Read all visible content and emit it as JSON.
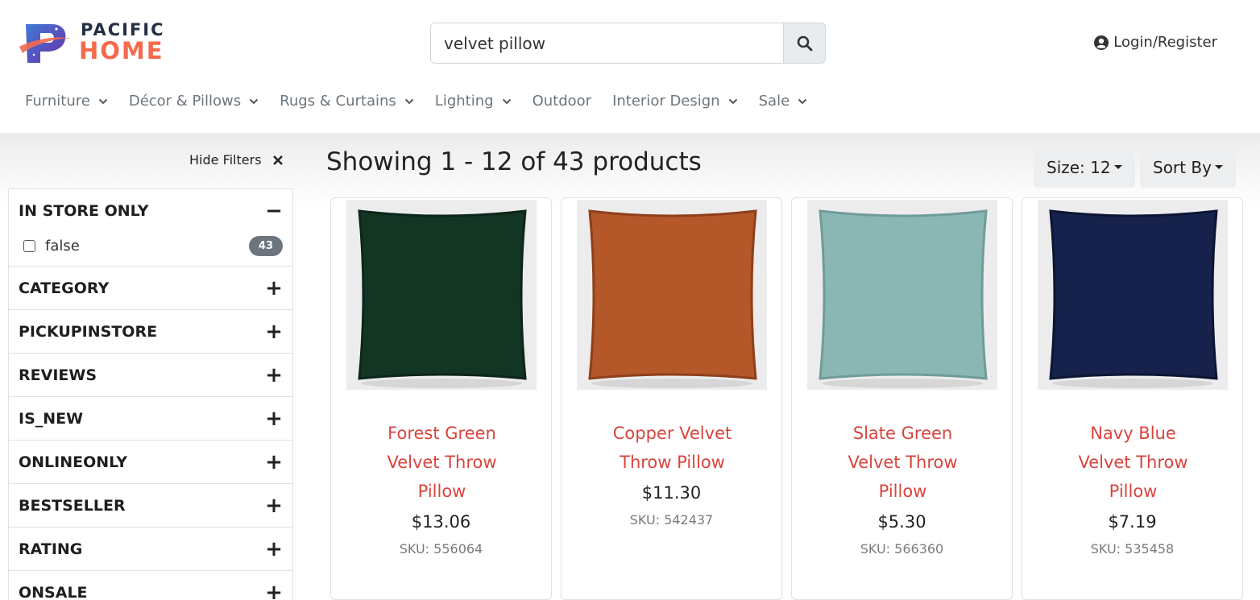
{
  "brand": {
    "line1": "PACIFIC",
    "line2": "HOME",
    "color_dark": "#243046",
    "color_accent": "#f46a4d"
  },
  "search": {
    "value": "velvet pillow",
    "icon": "search-icon"
  },
  "account": {
    "label": "Login/Register",
    "icon": "user-circle-icon"
  },
  "nav": {
    "items": [
      {
        "label": "Furniture",
        "has_dropdown": true
      },
      {
        "label": "Décor & Pillows",
        "has_dropdown": true
      },
      {
        "label": "Rugs & Curtains",
        "has_dropdown": true
      },
      {
        "label": "Lighting",
        "has_dropdown": true
      },
      {
        "label": "Outdoor",
        "has_dropdown": false
      },
      {
        "label": "Interior Design",
        "has_dropdown": true
      },
      {
        "label": "Sale",
        "has_dropdown": true
      }
    ]
  },
  "filters": {
    "hide_label": "Hide Filters",
    "groups": [
      {
        "title": "IN STORE ONLY",
        "toggle": "−",
        "expanded": true,
        "options": [
          {
            "label": "false",
            "count": "43",
            "checked": false
          }
        ]
      },
      {
        "title": "CATEGORY",
        "toggle": "+"
      },
      {
        "title": "PICKUPINSTORE",
        "toggle": "+"
      },
      {
        "title": "REVIEWS",
        "toggle": "+"
      },
      {
        "title": "IS_NEW",
        "toggle": "+"
      },
      {
        "title": "ONLINEONLY",
        "toggle": "+"
      },
      {
        "title": "BESTSELLER",
        "toggle": "+"
      },
      {
        "title": "RATING",
        "toggle": "+"
      },
      {
        "title": "ONSALE",
        "toggle": "+"
      }
    ]
  },
  "results": {
    "title": "Showing 1 - 12 of 43 products",
    "size_label": "Size: 12",
    "sort_label": "Sort By"
  },
  "products": [
    {
      "title_lines": [
        "Forest Green",
        "Velvet Throw",
        "Pillow"
      ],
      "price": "$13.06",
      "sku": "SKU: 556064",
      "color": "#123524",
      "edge": "#0c2619"
    },
    {
      "title_lines": [
        "Copper Velvet",
        "Throw Pillow"
      ],
      "price": "$11.30",
      "sku": "SKU: 542437",
      "color": "#b4582a",
      "edge": "#8f3f1b"
    },
    {
      "title_lines": [
        "Slate Green",
        "Velvet Throw",
        "Pillow"
      ],
      "price": "$5.30",
      "sku": "SKU: 566360",
      "color": "#8ab7b4",
      "edge": "#6f9c99"
    },
    {
      "title_lines": [
        "Navy Blue",
        "Velvet Throw",
        "Pillow"
      ],
      "price": "$7.19",
      "sku": "SKU: 535458",
      "color": "#16224b",
      "edge": "#0c1534"
    }
  ]
}
